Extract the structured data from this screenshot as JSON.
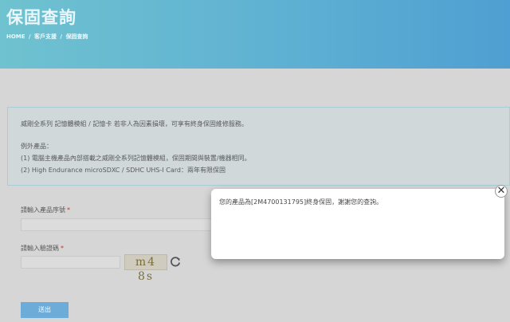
{
  "header": {
    "title": "保固查詢",
    "breadcrumb": [
      "HOME",
      "/",
      "客戶支援",
      "/",
      "保固查詢"
    ]
  },
  "info": {
    "line1": "威剛全系列 記憶體模組 / 記憶卡 若非人為因素損壞，可享有終身保固維修服務。",
    "line2": "例外產品：",
    "line3": "(1) 電腦主機產品內部搭載之威剛全系列記憶體模組，保固期間與裝置/機器相同。",
    "line4": "(2) High Endurance microSDXC / SDHC UHS-I Card：兩年有限保固"
  },
  "form": {
    "serial_label": "請輸入產品序號",
    "captcha_label": "請輸入驗證碼",
    "required_mark": "*",
    "captcha_text": "m4 8s",
    "submit_label": "送出"
  },
  "modal": {
    "message": "您的產品為[2M4700131795]終身保固，謝謝您的查詢。",
    "close_symbol": "✕"
  },
  "icons": {
    "refresh": "refresh-icon",
    "close": "close-icon"
  }
}
